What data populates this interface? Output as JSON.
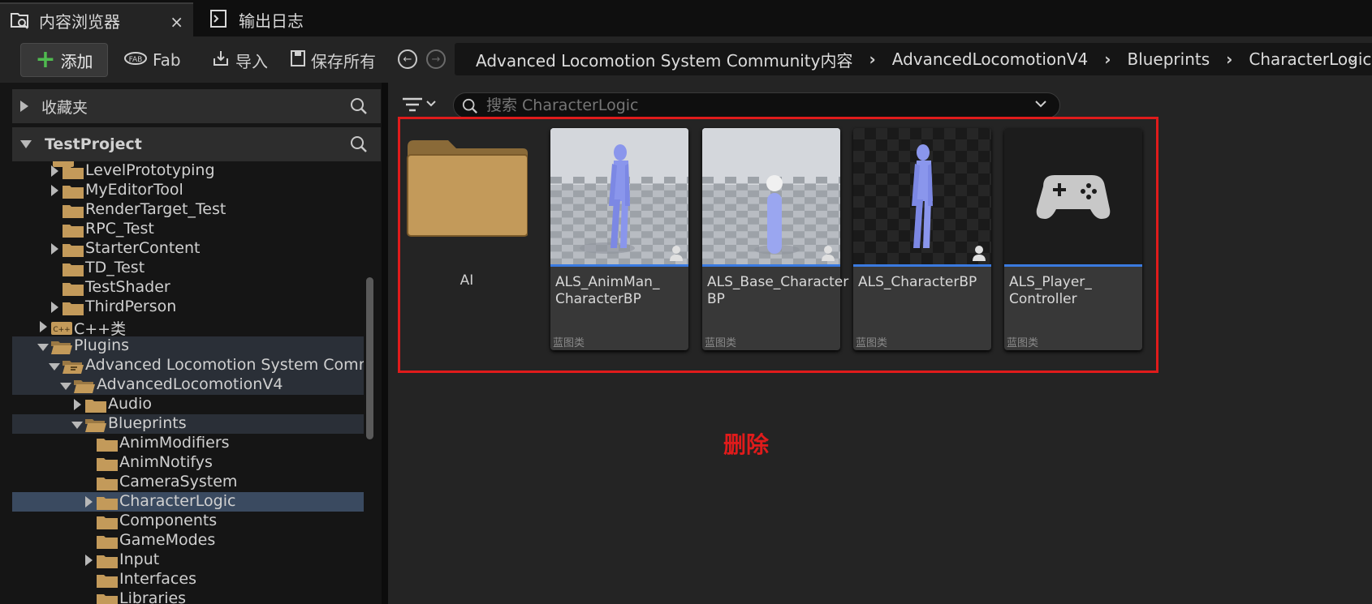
{
  "tabs": [
    {
      "label": "内容浏览器",
      "close": "×"
    },
    {
      "label": "输出日志"
    }
  ],
  "toolbar": {
    "add_label": "添加",
    "fab_label": "Fab",
    "import_label": "导入",
    "save_all_label": "保存所有"
  },
  "breadcrumb": {
    "items": [
      "Advanced Locomotion System Community内容",
      "AdvancedLocomotionV4",
      "Blueprints",
      "CharacterLogic"
    ]
  },
  "left_panel": {
    "favorites_label": "收藏夹",
    "project_label": "TestProject",
    "tree": [
      {
        "label": "LevelPrototyping",
        "expandable": true
      },
      {
        "label": "MyEditorTool",
        "expandable": true
      },
      {
        "label": "RenderTarget_Test",
        "expandable": false
      },
      {
        "label": "RPC_Test",
        "expandable": false
      },
      {
        "label": "StarterContent",
        "expandable": true
      },
      {
        "label": "TD_Test",
        "expandable": false
      },
      {
        "label": "TestShader",
        "expandable": false
      },
      {
        "label": "ThirdPerson",
        "expandable": true
      },
      {
        "label": "C++类",
        "expandable": true
      },
      {
        "label": "Plugins",
        "expandable": true
      },
      {
        "label": "Advanced Locomotion System Commun",
        "expandable": true
      },
      {
        "label": "AdvancedLocomotionV4",
        "expandable": true
      },
      {
        "label": "Audio",
        "expandable": true
      },
      {
        "label": "Blueprints",
        "expandable": true
      },
      {
        "label": "AnimModifiers",
        "expandable": false
      },
      {
        "label": "AnimNotifys",
        "expandable": false
      },
      {
        "label": "CameraSystem",
        "expandable": false
      },
      {
        "label": "CharacterLogic",
        "expandable": true
      },
      {
        "label": "Components",
        "expandable": false
      },
      {
        "label": "GameModes",
        "expandable": false
      },
      {
        "label": "Input",
        "expandable": true
      },
      {
        "label": "Interfaces",
        "expandable": false
      },
      {
        "label": "Libraries",
        "expandable": false
      }
    ]
  },
  "content": {
    "search_placeholder": "搜索 CharacterLogic",
    "folder_label": "AI",
    "assets": [
      {
        "name": "ALS_AnimMan_\nCharacterBP",
        "type": "蓝图类"
      },
      {
        "name": "ALS_Base_Character\nBP",
        "type": "蓝图类"
      },
      {
        "name": "ALS_CharacterBP",
        "type": "蓝图类"
      },
      {
        "name": "ALS_Player_\nController",
        "type": "蓝图类"
      }
    ],
    "annotation": "删除"
  },
  "colors": {
    "accent_green": "#4fba4f",
    "annotation_red": "#e01b1b",
    "asset_bar_blue": "#3a7ae0",
    "folder": "#c39a5a"
  }
}
